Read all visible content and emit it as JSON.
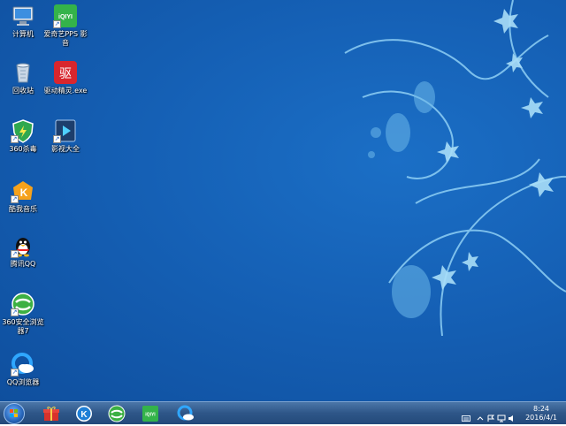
{
  "desktop": {
    "icons": [
      {
        "label": "计算机",
        "icon": "computer-icon"
      },
      {
        "label": "爱奇艺PPS 影音",
        "icon": "iqiyi-icon"
      },
      {
        "label": "回收站",
        "icon": "recycle-bin-icon"
      },
      {
        "label": "驱动精灵.exe",
        "icon": "driver-genius-icon"
      },
      {
        "label": "360杀毒",
        "icon": "360-antivirus-icon"
      },
      {
        "label": "影视大全",
        "icon": "video-player-icon"
      },
      {
        "label": "酷我音乐",
        "icon": "kuwo-music-icon"
      },
      {
        "label": "腾讯QQ",
        "icon": "qq-penguin-icon"
      },
      {
        "label": "360安全浏览器7",
        "icon": "360-browser-icon"
      },
      {
        "label": "QQ浏览器",
        "icon": "qq-browser-icon"
      }
    ],
    "driver_glyph": "驱",
    "iqiyi_glyph": "iQIYI"
  },
  "taskbar": {
    "pinned": [
      "gift-icon",
      "kuwo-k-icon",
      "360-browser-icon",
      "iqiyi-icon",
      "qq-browser-icon"
    ],
    "kuwo_glyph": "K",
    "clock": {
      "time": "8:24",
      "date": "2016/4/1"
    }
  },
  "colors": {
    "desktop": "#1560b5",
    "taskbar": "#2e5688"
  }
}
